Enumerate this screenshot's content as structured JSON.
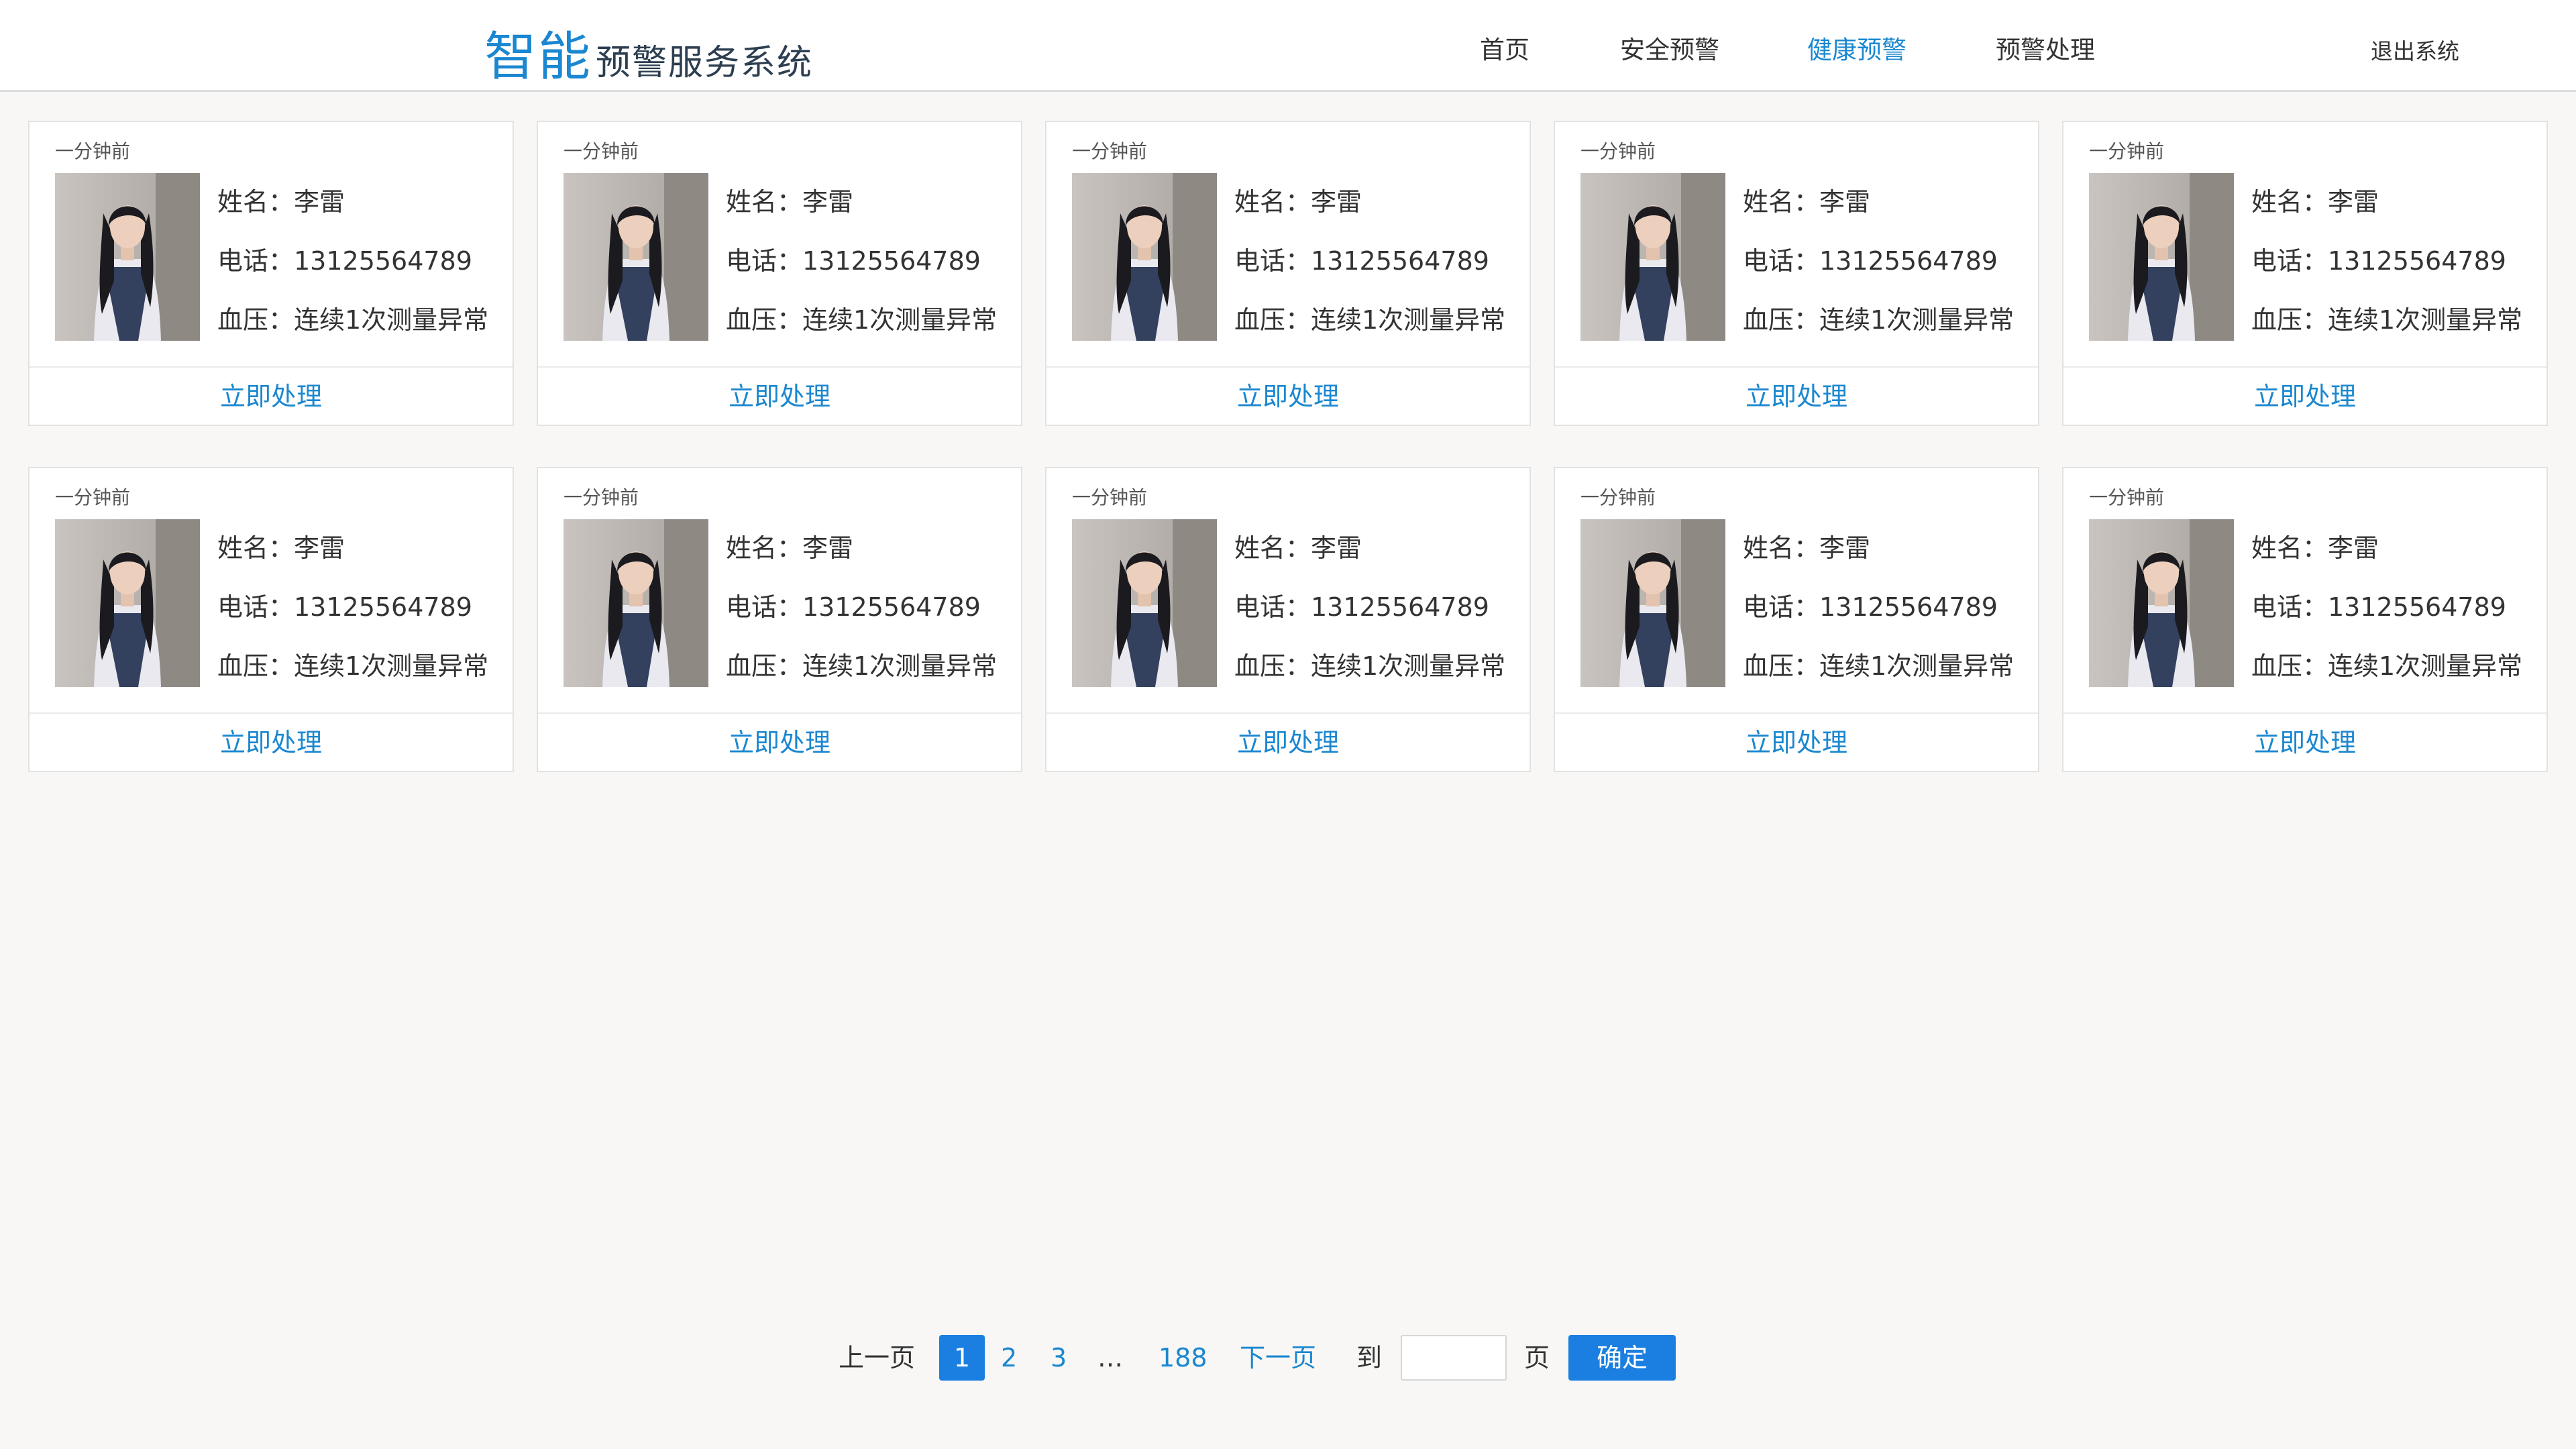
{
  "header": {
    "logo_big": "智能",
    "logo_small": "预警服务系统",
    "nav": [
      {
        "label": "首页"
      },
      {
        "label": "安全预警"
      },
      {
        "label": "健康预警",
        "active": true
      },
      {
        "label": "预警处理"
      }
    ],
    "logout": "退出系统"
  },
  "cards": [
    {
      "time": "一分钟前",
      "name_line": "姓名：李雷",
      "phone_line": "电话：13125564789",
      "bp_line": "血压：连续1次测量异常",
      "action": "立即处理"
    },
    {
      "time": "一分钟前",
      "name_line": "姓名：李雷",
      "phone_line": "电话：13125564789",
      "bp_line": "血压：连续1次测量异常",
      "action": "立即处理"
    },
    {
      "time": "一分钟前",
      "name_line": "姓名：李雷",
      "phone_line": "电话：13125564789",
      "bp_line": "血压：连续1次测量异常",
      "action": "立即处理"
    },
    {
      "time": "一分钟前",
      "name_line": "姓名：李雷",
      "phone_line": "电话：13125564789",
      "bp_line": "血压：连续1次测量异常",
      "action": "立即处理"
    },
    {
      "time": "一分钟前",
      "name_line": "姓名：李雷",
      "phone_line": "电话：13125564789",
      "bp_line": "血压：连续1次测量异常",
      "action": "立即处理"
    },
    {
      "time": "一分钟前",
      "name_line": "姓名：李雷",
      "phone_line": "电话：13125564789",
      "bp_line": "血压：连续1次测量异常",
      "action": "立即处理"
    },
    {
      "time": "一分钟前",
      "name_line": "姓名：李雷",
      "phone_line": "电话：13125564789",
      "bp_line": "血压：连续1次测量异常",
      "action": "立即处理"
    },
    {
      "time": "一分钟前",
      "name_line": "姓名：李雷",
      "phone_line": "电话：13125564789",
      "bp_line": "血压：连续1次测量异常",
      "action": "立即处理"
    },
    {
      "time": "一分钟前",
      "name_line": "姓名：李雷",
      "phone_line": "电话：13125564789",
      "bp_line": "血压：连续1次测量异常",
      "action": "立即处理"
    },
    {
      "time": "一分钟前",
      "name_line": "姓名：李雷",
      "phone_line": "电话：13125564789",
      "bp_line": "血压：连续1次测量异常",
      "action": "立即处理"
    }
  ],
  "pagination": {
    "prev": "上一页",
    "current": "1",
    "page2": "2",
    "page3": "3",
    "ellipsis": "…",
    "last": "188",
    "next": "下一页",
    "goto": "到",
    "input_value": "",
    "page_unit": "页",
    "confirm": "确定"
  },
  "colors": {
    "accent": "#1a87d0",
    "button": "#1a7fe0",
    "background": "#f8f7f6"
  }
}
